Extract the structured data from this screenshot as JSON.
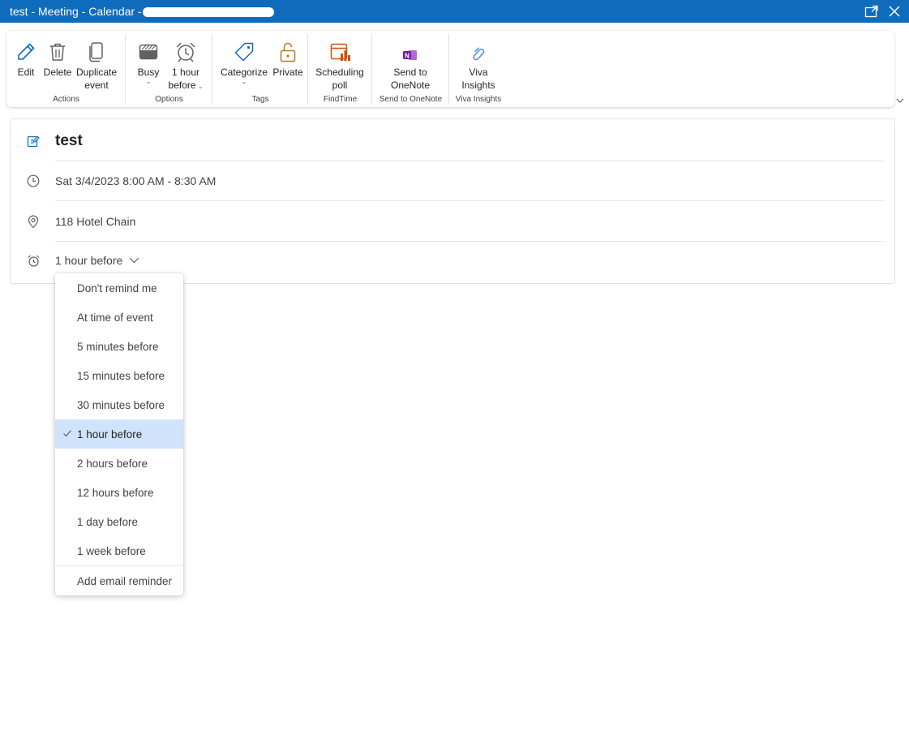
{
  "window": {
    "title": "test - Meeting - Calendar -",
    "popout_icon": "popout-icon",
    "close_icon": "close-icon"
  },
  "ribbon": {
    "groups": [
      {
        "label": "Actions",
        "buttons": [
          {
            "label": "Edit",
            "icon": "edit-icon"
          },
          {
            "label": "Delete",
            "icon": "delete-icon"
          },
          {
            "label": "Duplicate event",
            "line1": "Duplicate",
            "line2": "event",
            "icon": "duplicate-icon"
          }
        ]
      },
      {
        "label": "Options",
        "buttons": [
          {
            "label": "Busy",
            "icon": "busy-icon"
          },
          {
            "label": "1 hour before",
            "line1": "1 hour",
            "line2": "before",
            "icon": "alarm-icon"
          }
        ]
      },
      {
        "label": "Tags",
        "buttons": [
          {
            "label": "Categorize",
            "icon": "tag-icon"
          },
          {
            "label": "Private",
            "icon": "lock-icon"
          }
        ]
      },
      {
        "label": "FindTime",
        "buttons": [
          {
            "label": "Scheduling poll",
            "line1": "Scheduling",
            "line2": "poll",
            "icon": "poll-icon"
          }
        ]
      },
      {
        "label": "Send to OneNote",
        "buttons": [
          {
            "label": "Send to OneNote",
            "line1": "Send to",
            "line2": "OneNote",
            "icon": "onenote-icon"
          }
        ]
      },
      {
        "label": "Viva Insights",
        "buttons": [
          {
            "label": "Viva Insights",
            "line1": "Viva",
            "line2": "Insights",
            "icon": "viva-insights-icon"
          }
        ]
      }
    ]
  },
  "event": {
    "subject": "test",
    "datetime": "Sat 3/4/2023 8:00 AM - 8:30 AM",
    "location": "118 Hotel Chain",
    "reminder": "1 hour before"
  },
  "reminder_menu": {
    "options": [
      "Don't remind me",
      "At time of event",
      "5 minutes before",
      "15 minutes before",
      "30 minutes before",
      "1 hour before",
      "2 hours before",
      "12 hours before",
      "1 day before",
      "1 week before"
    ],
    "selected": "1 hour before",
    "extra_option": "Add email reminder"
  },
  "colors": {
    "titlebar": "#0f6cbd",
    "selected_option": "#cfe4fa",
    "icon_blue": "#0f6cbd",
    "icon_orange": "#c94f0f",
    "icon_gold": "#b7791f",
    "onenote_purple": "#7719aa"
  }
}
